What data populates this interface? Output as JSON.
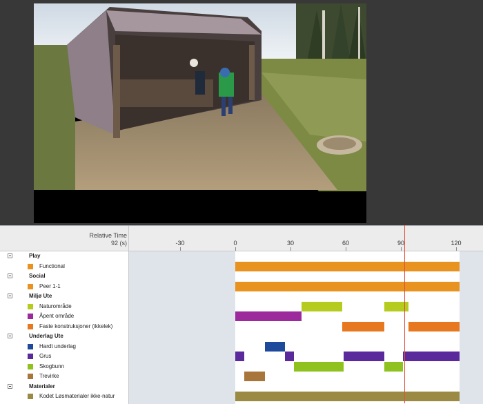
{
  "timeline": {
    "relative_time_label": "Relative Time",
    "relative_time_value": "92 (s)",
    "ticks": [
      {
        "label": "-30",
        "value": -30
      },
      {
        "label": "0",
        "value": 0
      },
      {
        "label": "30",
        "value": 30
      },
      {
        "label": "60",
        "value": 60
      },
      {
        "label": "90",
        "value": 90
      },
      {
        "label": "120",
        "value": 120
      }
    ],
    "playhead_seconds": 92,
    "range_seconds": [
      0,
      122
    ]
  },
  "groups": [
    {
      "id": "play",
      "label": "Play",
      "items": [
        {
          "id": "functional",
          "label": "Functional",
          "color": "#e8921f",
          "segments": [
            [
              0,
              122
            ]
          ]
        }
      ]
    },
    {
      "id": "social",
      "label": "Social",
      "items": [
        {
          "id": "peer",
          "label": "Peer 1-1",
          "color": "#e8921f",
          "segments": [
            [
              0,
              122
            ]
          ]
        }
      ]
    },
    {
      "id": "miljo",
      "label": "Miljø Ute",
      "items": [
        {
          "id": "naturomrade",
          "label": "Naturområde",
          "color": "#b5cc1e",
          "segments": [
            [
              36,
              58
            ],
            [
              81,
              94
            ]
          ]
        },
        {
          "id": "apent",
          "label": "Åpent område",
          "color": "#9c2a9c",
          "segments": [
            [
              0,
              36
            ]
          ]
        },
        {
          "id": "faste",
          "label": "Faste konstruksjoner (ikkelek)",
          "color": "#e8781f",
          "segments": [
            [
              58,
              81
            ],
            [
              94,
              122
            ]
          ]
        }
      ]
    },
    {
      "id": "underlag",
      "label": "Underlag Ute",
      "items": [
        {
          "id": "hardt",
          "label": "Hardt underlag",
          "color": "#1f4a9c",
          "segments": [
            [
              16,
              27
            ]
          ]
        },
        {
          "id": "grus",
          "label": "Grus",
          "color": "#5a2a9c",
          "segments": [
            [
              0,
              5
            ],
            [
              27,
              32
            ],
            [
              59,
              81
            ],
            [
              91,
              122
            ]
          ]
        },
        {
          "id": "skogbunn",
          "label": "Skogbunn",
          "color": "#8fc21f",
          "segments": [
            [
              32,
              59
            ],
            [
              81,
              91
            ]
          ]
        },
        {
          "id": "trevirke",
          "label": "Trevirke",
          "color": "#a8763a",
          "segments": [
            [
              5,
              16
            ]
          ]
        }
      ]
    },
    {
      "id": "materialer",
      "label": "Materialer",
      "items": [
        {
          "id": "kodet",
          "label": "Kodet Løsmaterialer ikke-natur",
          "color": "#9a8a44",
          "segments": [
            [
              0,
              122
            ]
          ]
        }
      ]
    }
  ]
}
